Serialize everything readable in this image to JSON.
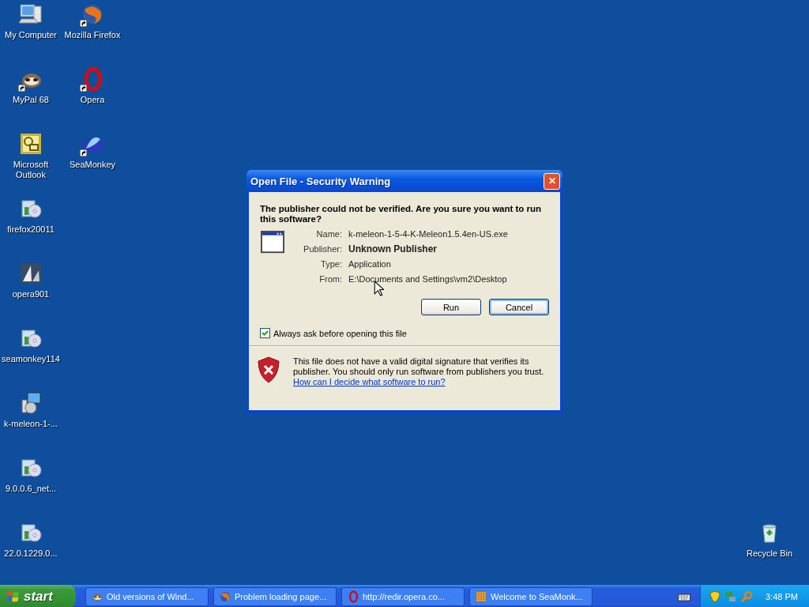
{
  "desktop": {
    "columns": [
      [
        {
          "label": "My Computer",
          "kind": "computer",
          "shortcut": false
        },
        {
          "label": "MyPal 68",
          "kind": "raccoon",
          "shortcut": true
        },
        {
          "label": "Microsoft Outlook",
          "kind": "outlook",
          "shortcut": false
        },
        {
          "label": "firefox20011",
          "kind": "installer",
          "shortcut": false
        },
        {
          "label": "opera901",
          "kind": "sails",
          "shortcut": false
        },
        {
          "label": "seamonkey114",
          "kind": "installer",
          "shortcut": false
        },
        {
          "label": "k-meleon-1-...",
          "kind": "setup",
          "shortcut": false
        },
        {
          "label": "9.0.0.6_net...",
          "kind": "installer",
          "shortcut": false
        },
        {
          "label": "22.0.1229.0...",
          "kind": "installer",
          "shortcut": false
        }
      ],
      [
        {
          "label": "Mozilla Firefox",
          "kind": "globe",
          "shortcut": true
        },
        {
          "label": "Opera",
          "kind": "letter-o",
          "shortcut": true
        },
        {
          "label": "SeaMonkey",
          "kind": "wave",
          "shortcut": true
        }
      ]
    ],
    "recycle_bin": {
      "label": "Recycle Bin",
      "kind": "bin",
      "shortcut": false
    }
  },
  "dialog": {
    "title": "Open File - Security Warning",
    "close": "✕",
    "question": "The publisher could not be verified.  Are you sure you want to run this software?",
    "fields": [
      {
        "key": "Name:",
        "value": "k-meleon-1-5-4-K-Meleon1.5.4en-US.exe",
        "bold": false
      },
      {
        "key": "Publisher:",
        "value": "Unknown Publisher",
        "bold": true
      },
      {
        "key": "Type:",
        "value": "Application",
        "bold": false
      },
      {
        "key": "From:",
        "value": "E:\\Documents and Settings\\vm2\\Desktop",
        "bold": false
      }
    ],
    "buttons": [
      {
        "label": "Run",
        "focused": false
      },
      {
        "label": "Cancel",
        "focused": true
      }
    ],
    "checkbox": {
      "label": "Always ask before opening this file",
      "checked": true
    },
    "warning": "This file does not have a valid digital signature that verifies its publisher.  You should only run software from publishers you trust.",
    "link": "How can I decide what software to run?"
  },
  "taskbar": {
    "start": "start",
    "tasks": [
      {
        "label": "Old versions of Wind...",
        "kind": "raccoon"
      },
      {
        "label": "Problem loading page...",
        "kind": "globe"
      },
      {
        "label": "http://redir.opera.co...",
        "kind": "letter-o"
      },
      {
        "label": "Welcome to SeaMonk...",
        "kind": "grid"
      }
    ],
    "clock": "3:48 PM"
  }
}
